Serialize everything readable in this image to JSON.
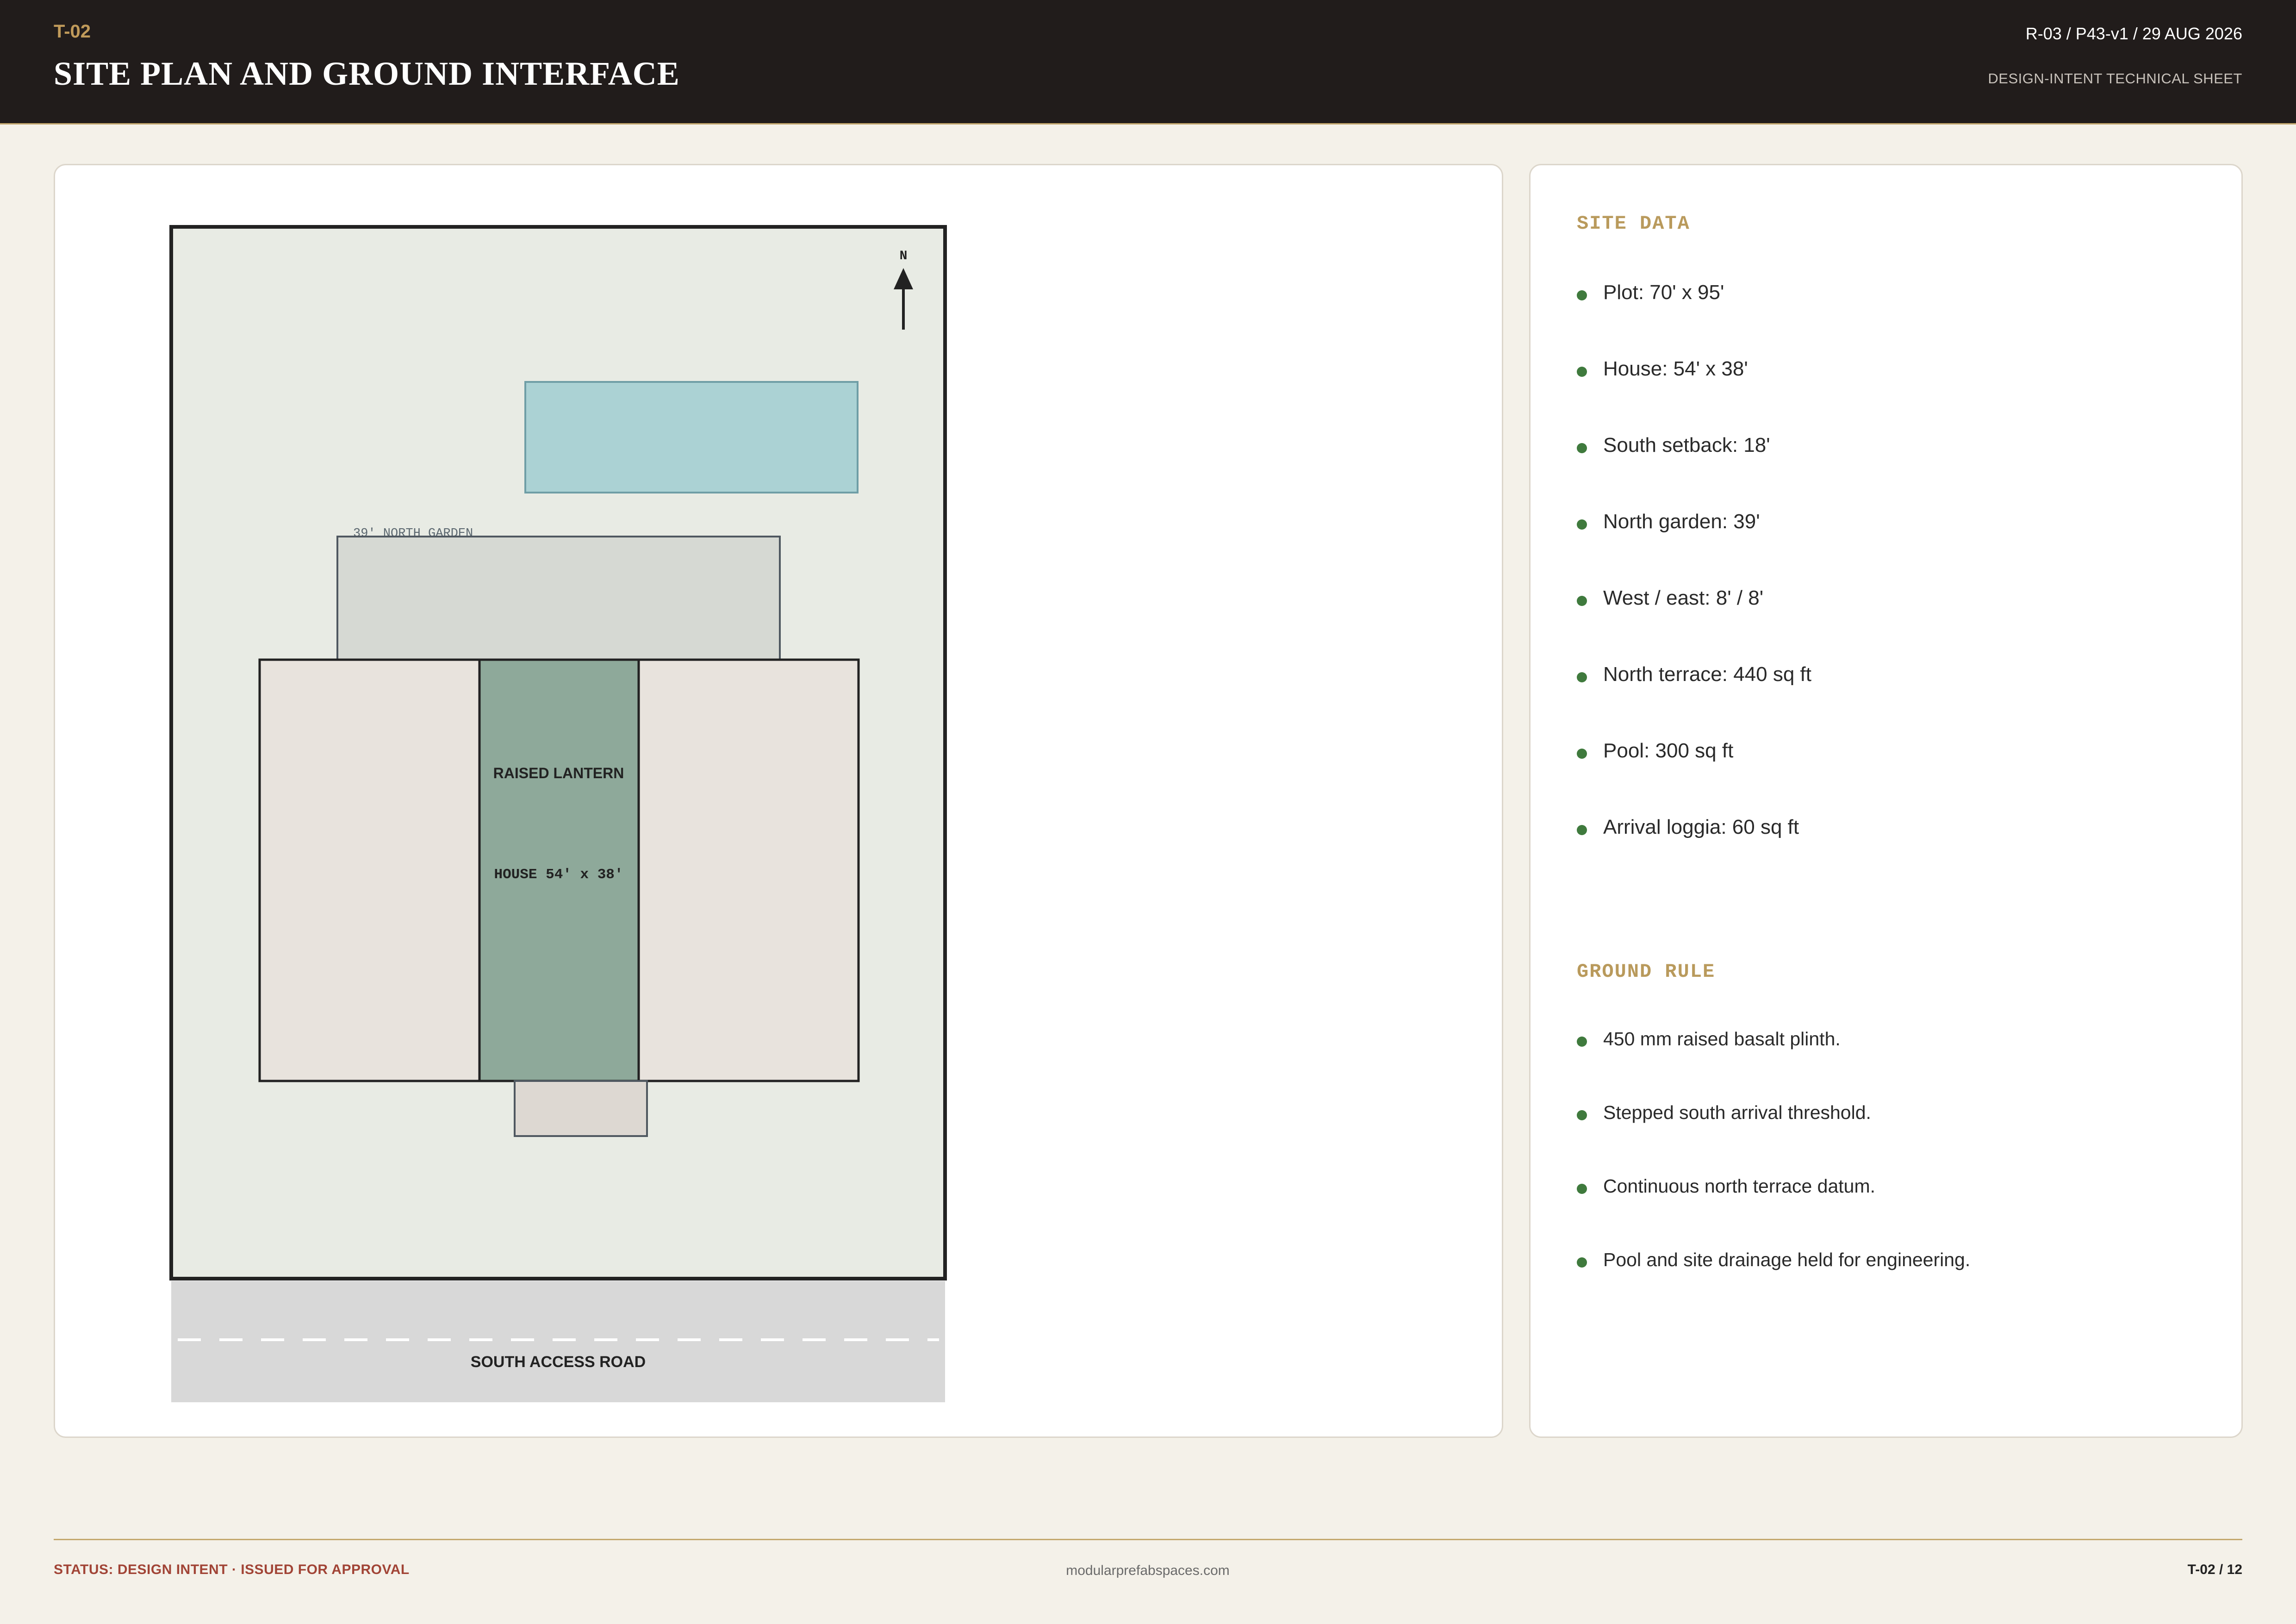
{
  "header": {
    "code": "T-02",
    "title": "SITE PLAN AND GROUND INTERFACE",
    "meta": "R-03 / P43-v1 / 29 AUG 2026",
    "subtitle": "DESIGN-INTENT TECHNICAL SHEET"
  },
  "plan": {
    "north_label": "N",
    "garden_label": "39' NORTH GARDEN",
    "lantern_label": "RAISED LANTERN",
    "house_label": "HOUSE 54' x 38'",
    "road_label": "SOUTH ACCESS ROAD"
  },
  "site_data": {
    "heading": "SITE DATA",
    "items": [
      "Plot: 70' x 95'",
      "House: 54' x 38'",
      "South setback: 18'",
      "North garden: 39'",
      "West / east: 8' / 8'",
      "North terrace: 440 sq ft",
      "Pool: 300 sq ft",
      "Arrival loggia: 60 sq ft"
    ]
  },
  "ground_rule": {
    "heading": "GROUND RULE",
    "items": [
      "450 mm raised basalt plinth.",
      "Stepped south arrival threshold.",
      "Continuous north terrace datum.",
      "Pool and site drainage held for engineering."
    ]
  },
  "footer": {
    "status": "STATUS: DESIGN INTENT · ISSUED FOR APPROVAL",
    "website": "modularprefabspaces.com",
    "page": "T-02 / 12"
  },
  "colors": {
    "header_bg": "#211c1b",
    "accent_gold": "#c09a5a",
    "bullet_green": "#3f7a3d",
    "status_red": "#a14436",
    "pool": "#abd2d4",
    "lantern": "#8ea99a",
    "site_ground": "#e8ebe4"
  }
}
